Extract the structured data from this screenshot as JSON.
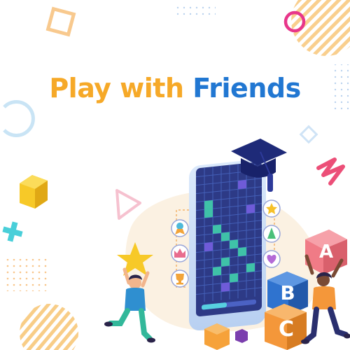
{
  "headline": {
    "part1": "Play with",
    "part2": "Friends"
  },
  "blocks": {
    "a": "A",
    "b": "B",
    "c": "C"
  },
  "colors": {
    "headline_orange": "#f6a928",
    "headline_blue": "#2177d2",
    "phone_screen": "#2d3a86",
    "block_pink": "#f07b86",
    "block_blue": "#2f73cf",
    "block_orange": "#f4973a",
    "accent_yellow": "#f7c928",
    "accent_pink": "#e8368a",
    "accent_teal": "#49cfd9"
  },
  "icons": [
    "hollow-square-icon",
    "pink-ring-icon",
    "striped-circle-icon",
    "dot-grid-icon",
    "blue-ring-icon",
    "hollow-diamond-icon",
    "yellow-cube-icon",
    "teal-cross-icon",
    "pink-triangle-icon",
    "pink-squiggle-icon",
    "graduation-cap-icon",
    "star-icon",
    "award-badge-icon",
    "crown-icon",
    "trophy-icon",
    "game-piece-icon",
    "heart-icon"
  ]
}
